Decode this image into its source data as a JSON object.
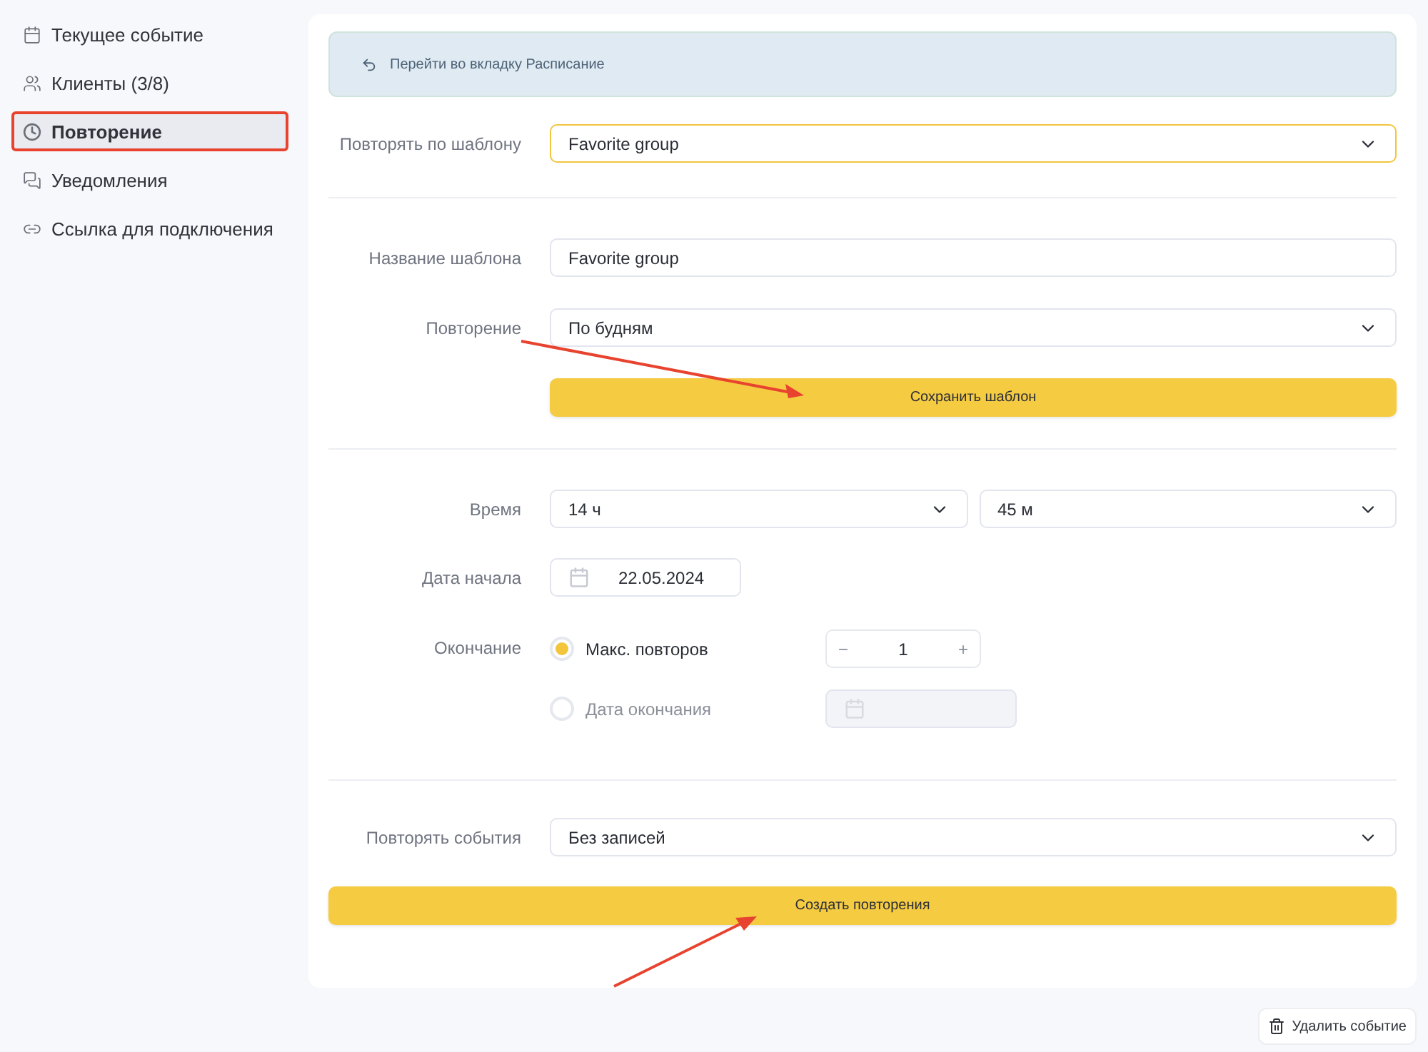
{
  "sidebar": {
    "items": [
      {
        "label": "Текущее событие",
        "kind": "calendar",
        "selected": false
      },
      {
        "label": "Клиенты (3/8)",
        "kind": "users",
        "selected": false
      },
      {
        "label": "Повторение",
        "kind": "clock",
        "selected": true
      },
      {
        "label": "Уведомления",
        "kind": "chat",
        "selected": false
      },
      {
        "label": "Ссылка для подключения",
        "kind": "link",
        "selected": false
      }
    ]
  },
  "notice": {
    "text": "Перейти во вкладку Расписание"
  },
  "template_select": {
    "label": "Повторять по шаблону",
    "value": "Favorite group",
    "focused": true
  },
  "template": {
    "name_label": "Название шаблона",
    "name_value": "Favorite group",
    "repeat_label": "Повторение",
    "repeat_value": "По будням",
    "save_button": "Сохранить шаблон"
  },
  "schedule": {
    "time_label": "Время",
    "hours": "14 ч",
    "minutes": "45 м",
    "start_label": "Дата начала",
    "start_date": "22.05.2024",
    "end_label": "Окончание",
    "end_options": [
      {
        "kind": "counter",
        "label": "Макс. повторов",
        "selected": true,
        "value": "1",
        "minus": "−",
        "plus": "+"
      },
      {
        "kind": "date",
        "label": "Дата окончания",
        "selected": false,
        "disabled": true
      }
    ]
  },
  "repeat_events": {
    "label": "Повторять события",
    "value": "Без записей",
    "create_button": "Создать повторения"
  },
  "delete_button": "Удалить событие"
}
